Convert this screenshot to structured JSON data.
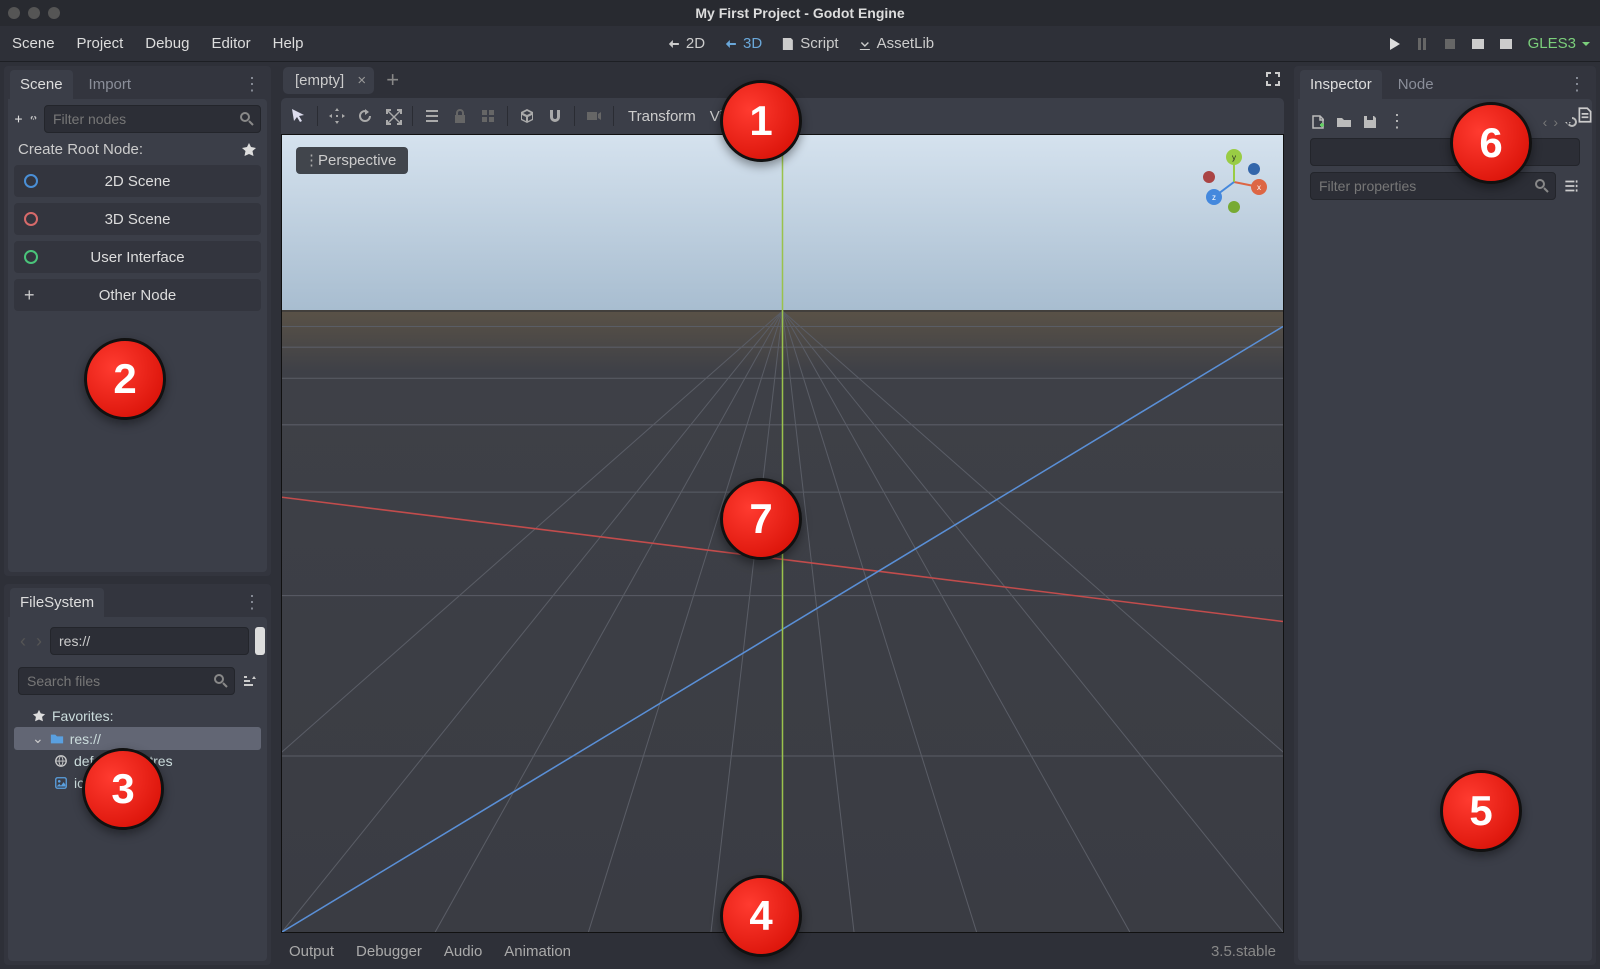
{
  "window": {
    "title": "My First Project - Godot Engine"
  },
  "menubar": {
    "items": [
      "Scene",
      "Project",
      "Debug",
      "Editor",
      "Help"
    ]
  },
  "workspace_tabs": {
    "items": [
      "2D",
      "3D",
      "Script",
      "AssetLib"
    ],
    "active": "3D"
  },
  "renderer": {
    "label": "GLES3"
  },
  "left": {
    "scene_tab": "Scene",
    "import_tab": "Import",
    "filter_placeholder": "Filter nodes",
    "root_label": "Create Root Node:",
    "root_options": {
      "scene2d": "2D Scene",
      "scene3d": "3D Scene",
      "ui": "User Interface",
      "other": "Other Node"
    },
    "root_colors": {
      "scene2d": "#4a8fd6",
      "scene3d": "#d66a6a",
      "ui": "#4ac47a"
    }
  },
  "filesystem": {
    "tab": "FileSystem",
    "path": "res://",
    "search_placeholder": "Search files",
    "favorites_label": "Favorites:",
    "root_label": "res://",
    "files": [
      "default_env.tres",
      "icon.png"
    ]
  },
  "center": {
    "open_tab": "[empty]",
    "perspective_label": "Perspective",
    "transform_label": "Transform",
    "view_label": "View"
  },
  "bottom": {
    "tabs": [
      "Output",
      "Debugger",
      "Audio",
      "Animation"
    ],
    "version": "3.5.stable"
  },
  "right": {
    "inspector_tab": "Inspector",
    "node_tab": "Node",
    "filter_placeholder": "Filter properties"
  },
  "annotations": [
    "1",
    "2",
    "3",
    "4",
    "5",
    "6",
    "7"
  ]
}
